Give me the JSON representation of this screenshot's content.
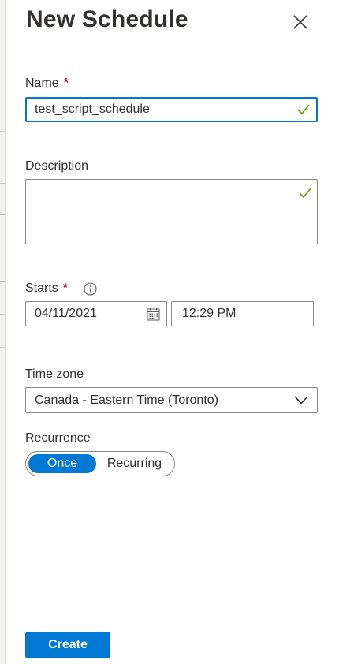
{
  "panel": {
    "title": "New Schedule",
    "close_icon": "close-icon"
  },
  "form": {
    "name": {
      "label": "Name",
      "required_marker": "*",
      "value": "test_script_schedule",
      "valid_icon": "checkmark-icon"
    },
    "description": {
      "label": "Description",
      "value": "",
      "valid_icon": "checkmark-icon"
    },
    "starts": {
      "label": "Starts",
      "required_marker": "*",
      "info_icon": "info-icon",
      "date": "04/11/2021",
      "calendar_icon": "calendar-icon",
      "time": "12:29 PM"
    },
    "timezone": {
      "label": "Time zone",
      "selected": "Canada - Eastern Time (Toronto)",
      "dropdown_icon": "chevron-down-icon"
    },
    "recurrence": {
      "label": "Recurrence",
      "options": [
        "Once",
        "Recurring"
      ],
      "selected": "Once"
    }
  },
  "footer": {
    "create_label": "Create"
  },
  "colors": {
    "accent": "#0078d4",
    "required": "#a4262c",
    "valid": "#57a300",
    "text": "#323130",
    "border": "#8a8886"
  }
}
